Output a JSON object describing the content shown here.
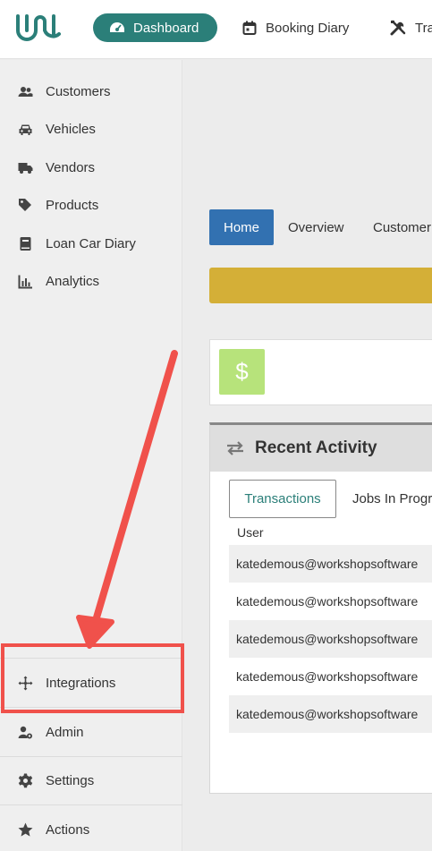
{
  "topnav": {
    "dashboard": "Dashboard",
    "booking_diary": "Booking Diary",
    "tools_partial": "Tra"
  },
  "sidebar": {
    "items": [
      {
        "label": "Customers",
        "icon": "users-icon"
      },
      {
        "label": "Vehicles",
        "icon": "car-icon"
      },
      {
        "label": "Vendors",
        "icon": "truck-icon"
      },
      {
        "label": "Products",
        "icon": "tags-icon"
      },
      {
        "label": "Loan Car Diary",
        "icon": "book-icon"
      },
      {
        "label": "Analytics",
        "icon": "bar-chart-icon"
      }
    ],
    "bottom_items": [
      {
        "label": "Integrations",
        "icon": "arrows-move-icon"
      },
      {
        "label": "Admin",
        "icon": "user-gear-icon"
      },
      {
        "label": "Settings",
        "icon": "gear-icon"
      },
      {
        "label": "Actions",
        "icon": "star-icon"
      }
    ]
  },
  "tabs": {
    "home": "Home",
    "overview": "Overview",
    "customer": "Customer"
  },
  "stat_card": {
    "symbol": "$"
  },
  "recent_activity": {
    "title": "Recent Activity",
    "tabs": [
      "Transactions",
      "Jobs In Progr"
    ],
    "column_user": "User",
    "rows": [
      "katedemous@workshopsoftware",
      "katedemous@workshopsoftware",
      "katedemous@workshopsoftware",
      "katedemous@workshopsoftware",
      "katedemous@workshopsoftware"
    ]
  },
  "colors": {
    "brand_teal": "#2b7f79",
    "home_blue": "#3271b1",
    "banner_gold": "#d4af37",
    "dollar_green": "#b7e37b",
    "highlight_red": "#f0514b"
  }
}
